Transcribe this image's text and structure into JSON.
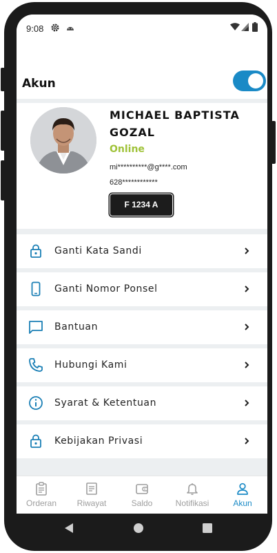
{
  "status_bar": {
    "time": "9:08",
    "icons": [
      "gear-icon",
      "android-icon",
      "wifi-icon",
      "signal-icon",
      "battery-icon"
    ]
  },
  "app_bar": {
    "title": "Akun",
    "toggle_on": true
  },
  "profile": {
    "name": "MICHAEL BAPTISTA GOZAL",
    "status": "Online",
    "email": "mi**********@g****.com",
    "phone": "628************",
    "plate": "F 1234 A"
  },
  "menu": [
    {
      "label": "Ganti Kata Sandi",
      "icon": "lock-icon"
    },
    {
      "label": "Ganti Nomor Ponsel",
      "icon": "smartphone-icon"
    },
    {
      "label": "Bantuan",
      "icon": "chat-icon"
    },
    {
      "label": "Hubungi Kami",
      "icon": "phone-icon"
    },
    {
      "label": "Syarat & Ketentuan",
      "icon": "info-icon"
    },
    {
      "label": "Kebijakan Privasi",
      "icon": "lock-icon"
    }
  ],
  "bottom_nav": [
    {
      "label": "Orderan",
      "icon": "clipboard-icon",
      "active": false
    },
    {
      "label": "Riwayat",
      "icon": "receipt-icon",
      "active": false
    },
    {
      "label": "Saldo",
      "icon": "wallet-icon",
      "active": false
    },
    {
      "label": "Notifikasi",
      "icon": "bell-icon",
      "active": false
    },
    {
      "label": "Akun",
      "icon": "person-icon",
      "active": true
    }
  ],
  "colors": {
    "accent": "#1a8ac6",
    "online": "#9fc238",
    "frame": "#1b1b1b",
    "background": "#eceff1"
  }
}
